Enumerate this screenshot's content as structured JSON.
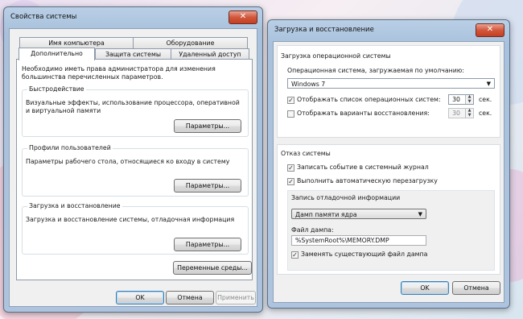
{
  "left_window": {
    "title": "Свойства системы",
    "close_glyph": "✕",
    "tabs_top": [
      "Имя компьютера",
      "Оборудование"
    ],
    "tabs_bottom": [
      "Дополнительно",
      "Защита системы",
      "Удаленный доступ"
    ],
    "admin_note": "Необходимо иметь права администратора для изменения большинства перечисленных параметров.",
    "performance": {
      "title": "Быстродействие",
      "desc": "Визуальные эффекты, использование процессора, оперативной и виртуальной памяти",
      "button": "Параметры..."
    },
    "profiles": {
      "title": "Профили пользователей",
      "desc": "Параметры рабочего стола, относящиеся ко входу в систему",
      "button": "Параметры..."
    },
    "startup": {
      "title": "Загрузка и восстановление",
      "desc": "Загрузка и восстановление системы, отладочная информация",
      "button": "Параметры..."
    },
    "env_button": "Переменные среды...",
    "ok": "OK",
    "cancel": "Отмена",
    "apply": "Применить"
  },
  "right_window": {
    "title": "Загрузка и восстановление",
    "close_glyph": "✕",
    "os_section": {
      "title": "Загрузка операционной системы",
      "default_label": "Операционная система, загружаемая по умолчанию:",
      "default_os": "Windows 7",
      "show_list_label": "Отображать список операционных систем:",
      "show_list_checked": true,
      "show_list_value": "30",
      "show_recovery_label": "Отображать варианты восстановления:",
      "show_recovery_checked": false,
      "show_recovery_value": "30",
      "sec_unit": "сек."
    },
    "failure_section": {
      "title": "Отказ системы",
      "write_event_label": "Записать событие в системный журнал",
      "write_event_checked": true,
      "auto_restart_label": "Выполнить автоматическую перезагрузку",
      "auto_restart_checked": true,
      "debug_title": "Запись отладочной информации",
      "debug_type": "Дамп памяти ядра",
      "dump_file_label": "Файл дампа:",
      "dump_file_value": "%SystemRoot%\\MEMORY.DMP",
      "overwrite_label": "Заменять существующий файл дампа",
      "overwrite_checked": true
    },
    "ok": "OK",
    "cancel": "Отмена"
  },
  "check_glyph": "✓",
  "dropdown_arrow": "▼",
  "spin_up": "▲",
  "spin_down": "▼"
}
